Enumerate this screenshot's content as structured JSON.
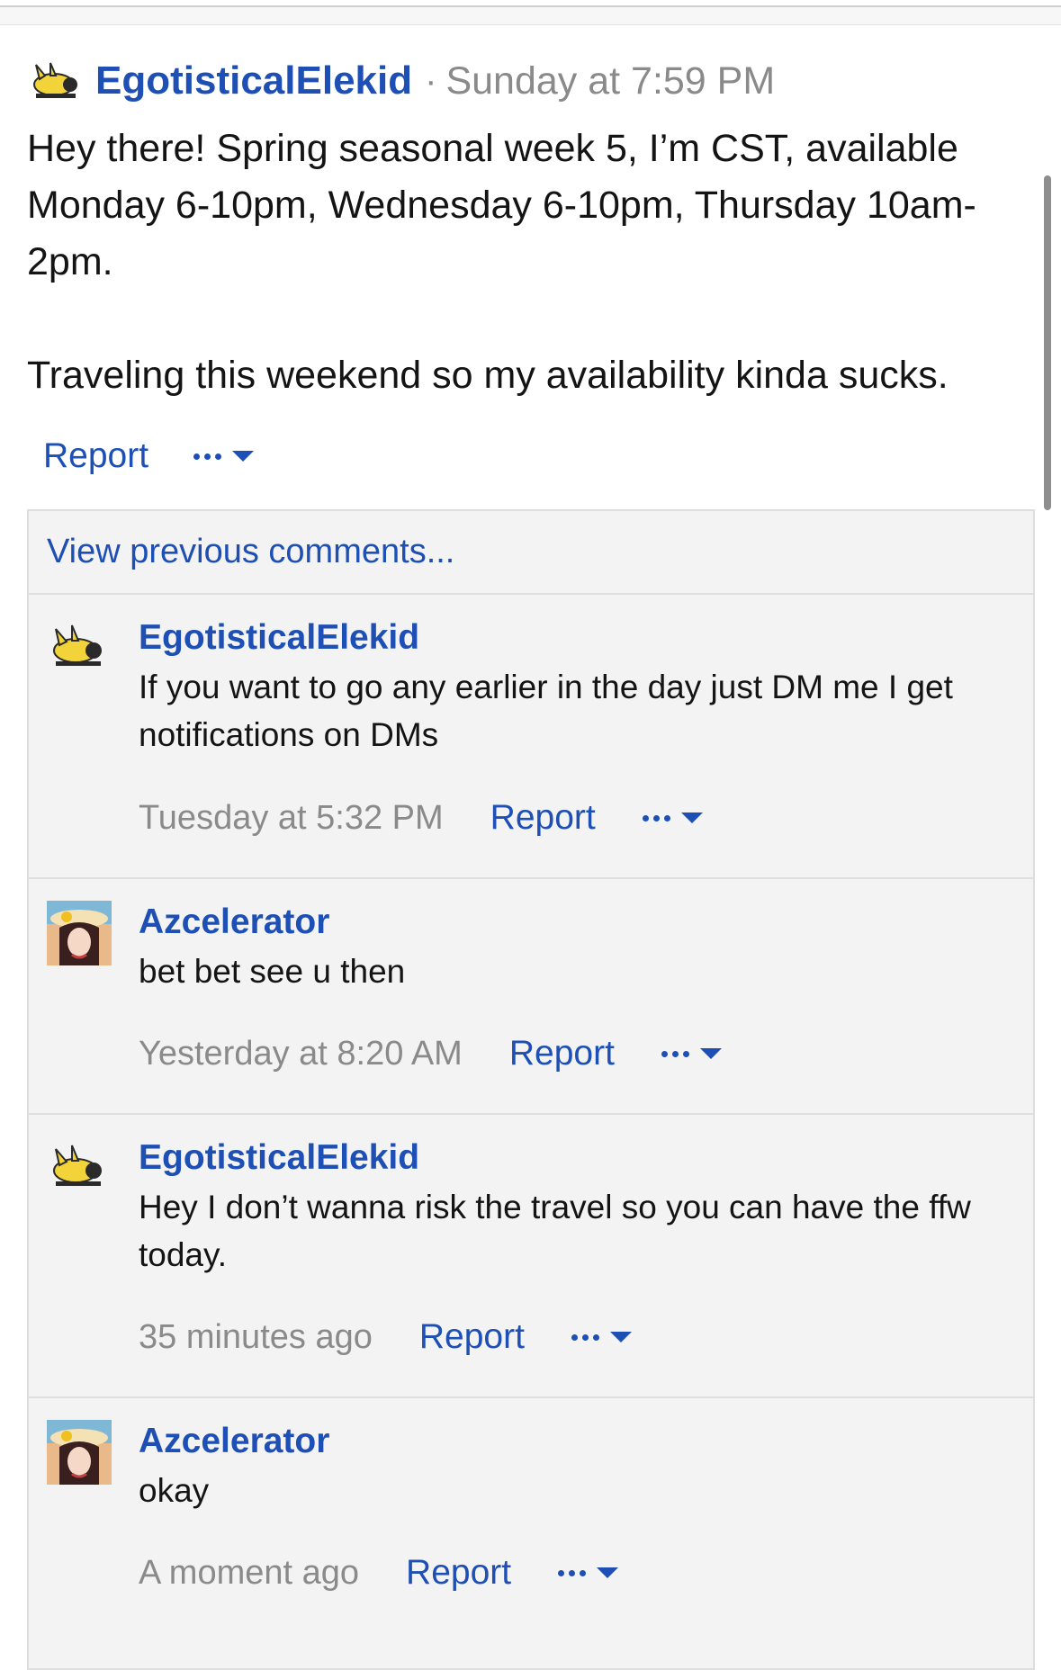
{
  "post": {
    "author": "EgotisticalElekid",
    "separator": "·",
    "date": "Sunday at 7:59 PM",
    "body_line1": "Hey there! Spring seasonal week 5, I’m CST, available Monday 6-10pm, Wednesday 6-10pm, Thursday 10am-2pm.",
    "body_line2": "Traveling this weekend so my availability kinda sucks.",
    "report_label": "Report"
  },
  "comments_section": {
    "view_previous_label": "View previous comments..."
  },
  "comments": [
    {
      "author": "EgotisticalElekid",
      "text": "If you want to go any earlier in the day just DM me I get notifications on DMs",
      "time": "Tuesday at 5:32 PM",
      "report_label": "Report"
    },
    {
      "author": "Azcelerator",
      "text": "bet bet see u then",
      "time": "Yesterday at 8:20 AM",
      "report_label": "Report"
    },
    {
      "author": "EgotisticalElekid",
      "text": "Hey I don’t wanna risk the travel so you can have the ffw today.",
      "time": "35 minutes ago",
      "report_label": "Report"
    },
    {
      "author": "Azcelerator",
      "text": "okay",
      "time": "A moment ago",
      "report_label": "Report"
    }
  ],
  "icons": {
    "more": "more-dots-icon",
    "caret": "caret-down-icon",
    "avatar_elekid": "elekid-avatar",
    "avatar_azcelerator": "azcelerator-avatar"
  },
  "colors": {
    "link": "#1d4fb4",
    "muted": "#8a8a8a",
    "comment_bg": "#f3f3f3"
  }
}
